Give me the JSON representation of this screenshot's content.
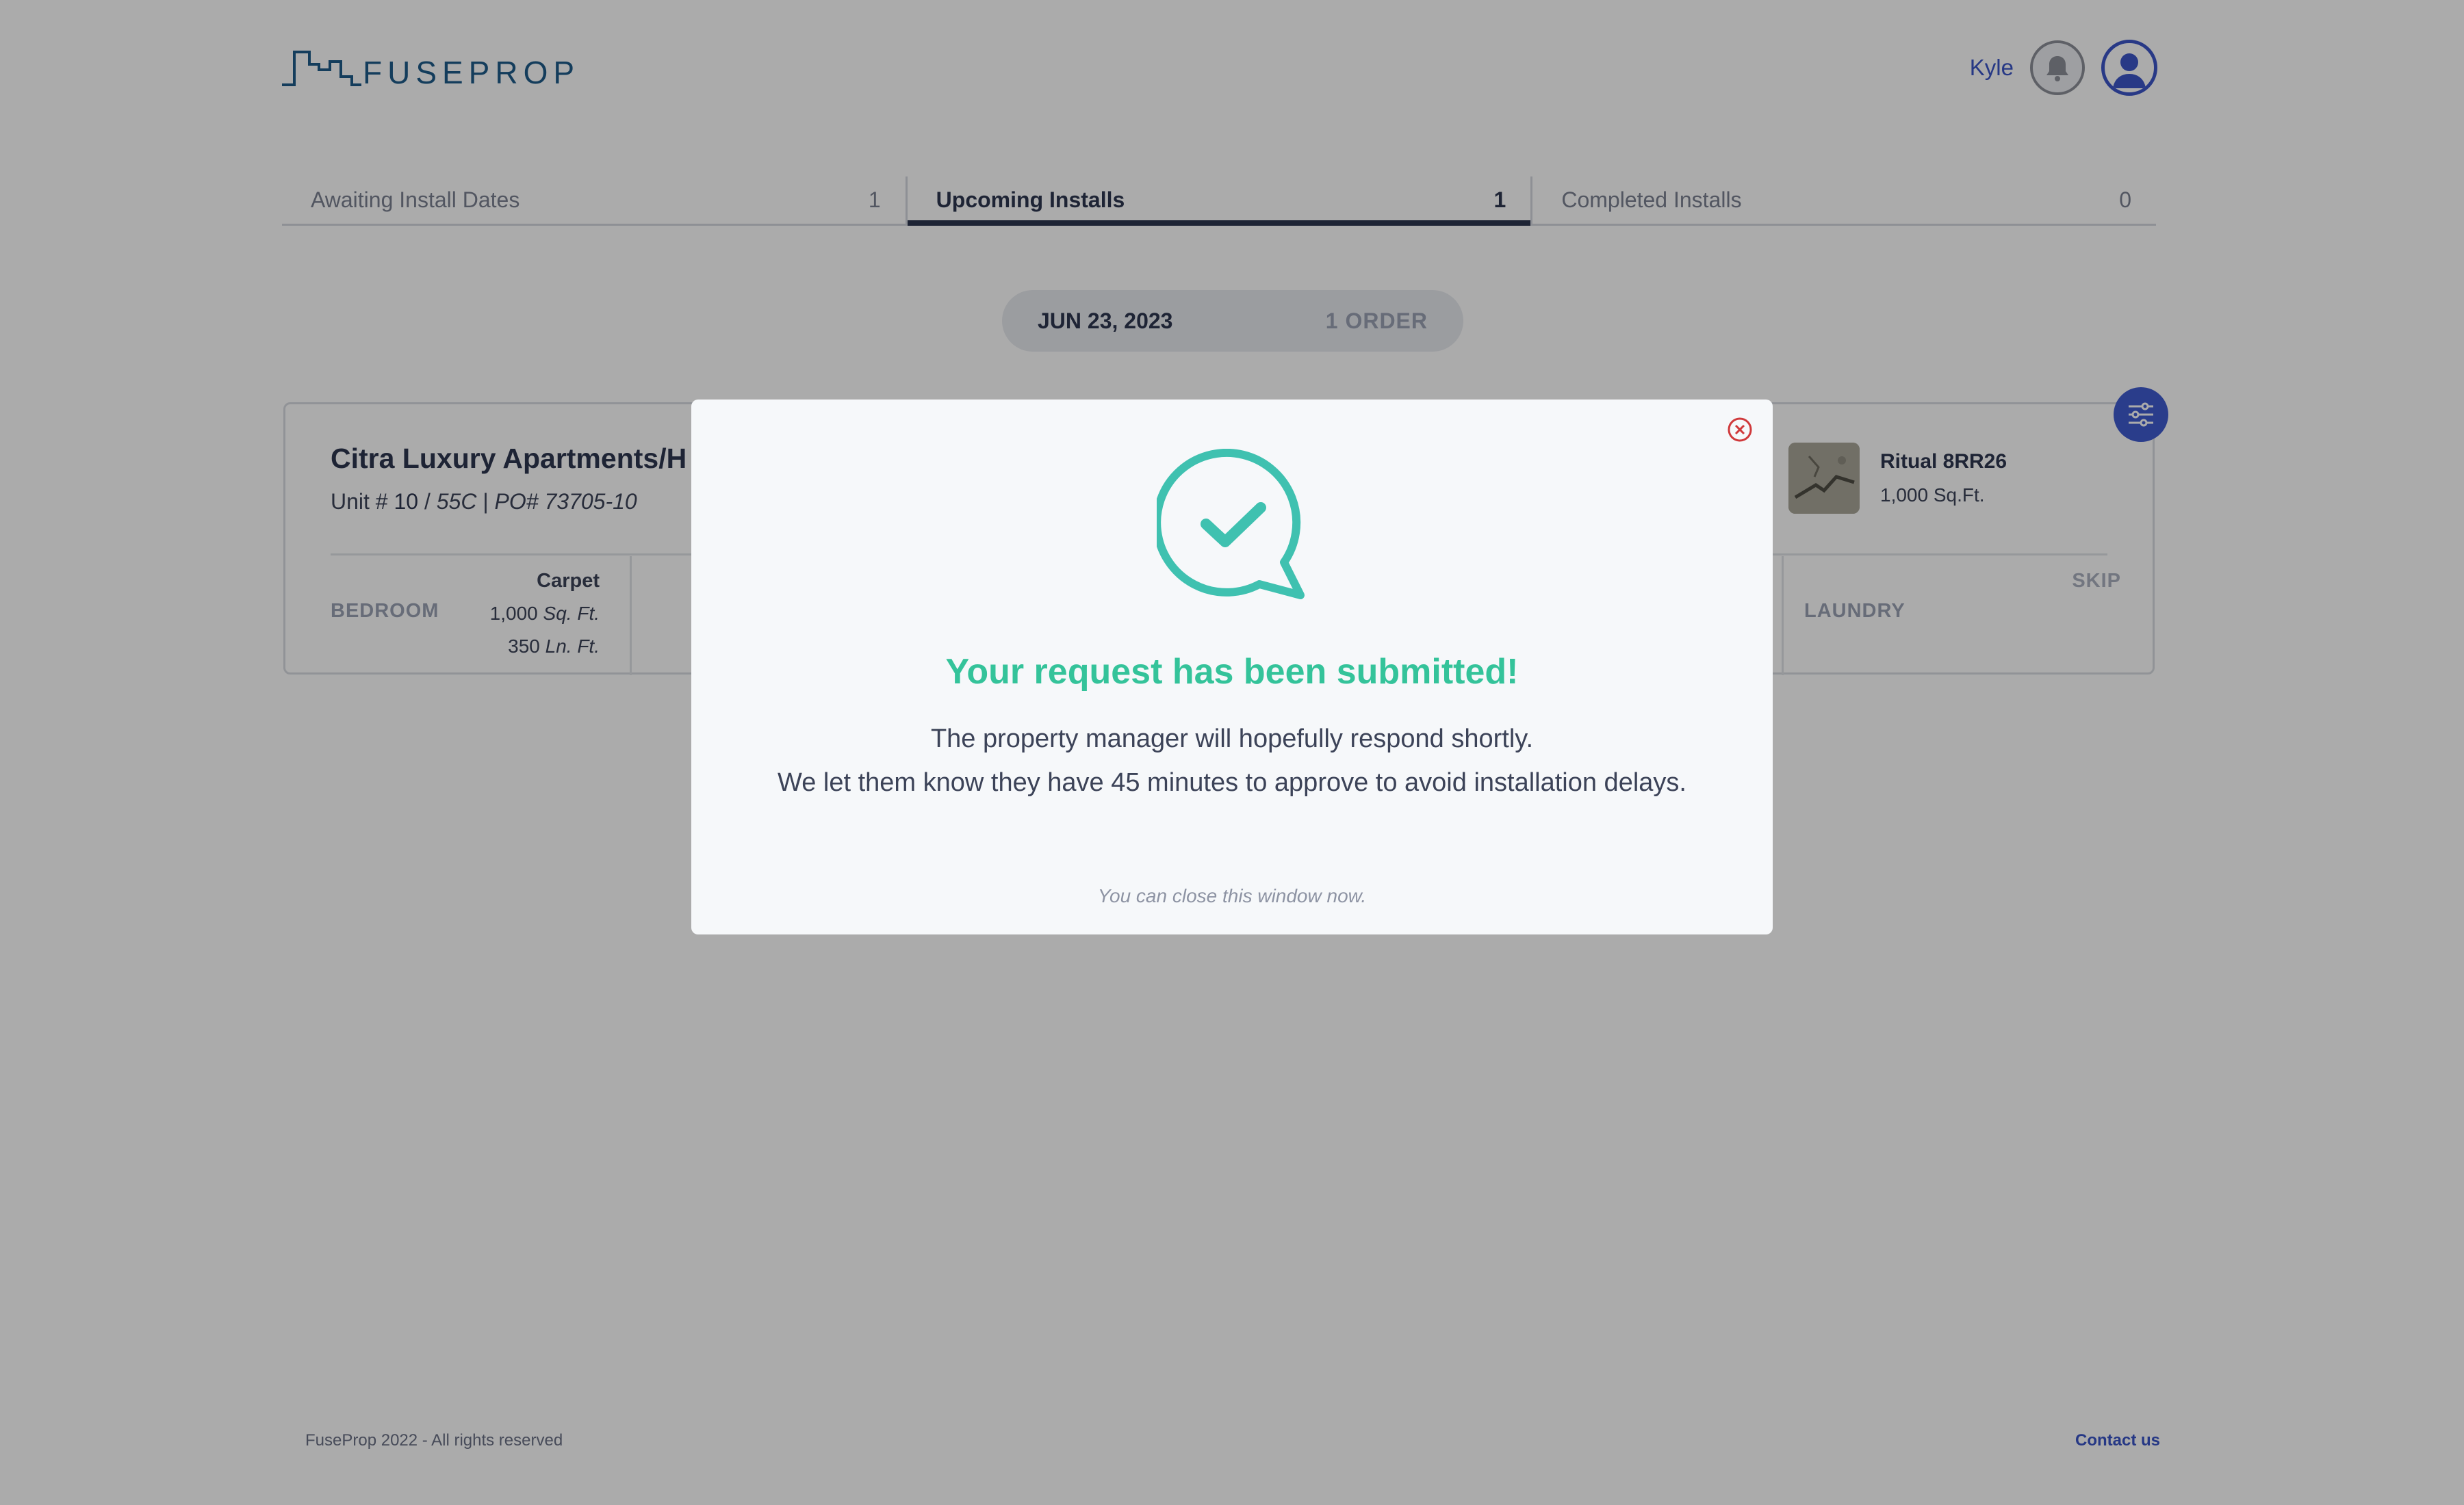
{
  "header": {
    "logo_text": "FUSEPROP",
    "user_name": "Kyle",
    "bell_icon": "bell-icon",
    "avatar_icon": "user-avatar-icon"
  },
  "tabs": [
    {
      "label": "Awaiting Install Dates",
      "count": "1",
      "active": false
    },
    {
      "label": "Upcoming Installs",
      "count": "1",
      "active": true
    },
    {
      "label": "Completed Installs",
      "count": "0",
      "active": false
    }
  ],
  "date_group": {
    "date": "JUN 23, 2023",
    "orders": "1 ORDER"
  },
  "order": {
    "title": "Citra Luxury Apartments/H",
    "unit_prefix": "Unit #",
    "unit_number": "10",
    "unit_type": "55C",
    "po_label": "PO# 73705-10",
    "rooms": {
      "bedroom": {
        "name": "BEDROOM",
        "material": "Carpet",
        "qty1_value": "1,000",
        "qty1_unit": "Sq. Ft.",
        "qty2_value": "350",
        "qty2_unit": "Ln. Ft."
      },
      "laundry": {
        "name": "LAUNDRY",
        "skip_label": "SKIP"
      }
    },
    "product": {
      "name": "Ritual 8RR26",
      "size": "1,000 Sq.Ft."
    },
    "filter_icon": "sliders-icon"
  },
  "modal": {
    "title": "Your request has been submitted!",
    "line1": "The property manager will hopefully respond shortly.",
    "line2": "We let them know they have 45 minutes to approve to avoid installation delays.",
    "hint": "You can close this window now.",
    "icon": "chat-check-icon",
    "close_icon": "close-circle-icon",
    "accent": "#34c39a",
    "icon_color": "#3fc1b0"
  },
  "footer": {
    "copyright": "FuseProp 2022 - All rights reserved",
    "contact": "Contact us"
  },
  "colors": {
    "brand_blue": "#3a54c6",
    "dark_text": "#2e3650",
    "overlay": "rgba(0,0,0,0.33)"
  }
}
